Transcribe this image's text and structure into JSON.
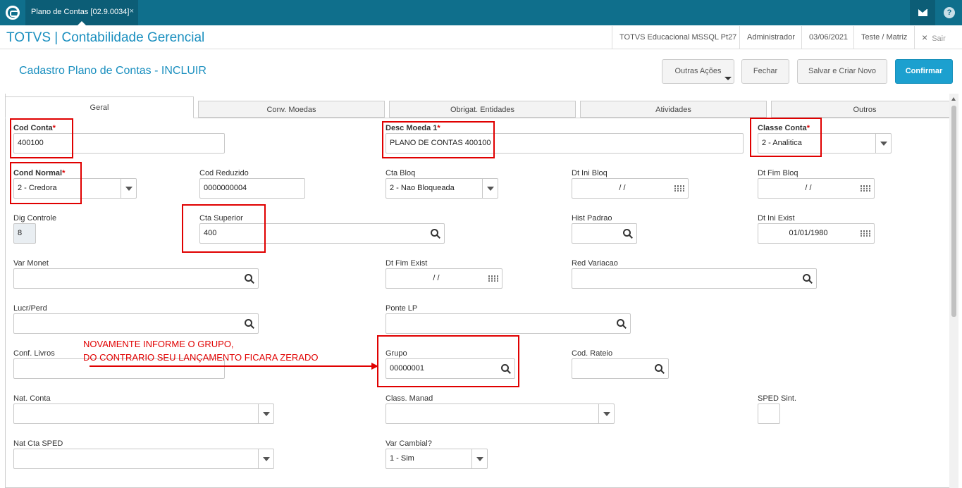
{
  "window": {
    "tab_title": "Plano de Contas [02.9.0034]",
    "tab_close": "×",
    "help": "?"
  },
  "header": {
    "app_title": "TOTVS | Contabilidade Gerencial",
    "environment": "TOTVS Educacional MSSQL Pt27",
    "user": "Administrador",
    "date": "03/06/2021",
    "company": "Teste / Matriz",
    "exit_label": "Sair",
    "exit_icon": "×"
  },
  "page": {
    "title": "Cadastro Plano de Contas - INCLUIR",
    "buttons": {
      "more_actions": "Outras Ações",
      "close": "Fechar",
      "save_new": "Salvar e Criar Novo",
      "confirm": "Confirmar"
    }
  },
  "tabs": [
    "Geral",
    "Conv. Moedas",
    "Obrigat. Entidades",
    "Atividades",
    "Outros"
  ],
  "fields": {
    "cod_conta": {
      "label": "Cod Conta",
      "value": "400100",
      "required": "*"
    },
    "desc_moeda": {
      "label": "Desc Moeda 1",
      "value": "PLANO DE CONTAS 400100",
      "required": "*"
    },
    "classe_conta": {
      "label": "Classe Conta",
      "value": "2 - Analitica",
      "required": "*"
    },
    "cond_normal": {
      "label": "Cond Normal",
      "value": "2 - Credora",
      "required": "*"
    },
    "cod_reduzido": {
      "label": "Cod Reduzido",
      "value": "0000000004"
    },
    "cta_bloq": {
      "label": "Cta Bloq",
      "value": "2 - Nao Bloqueada"
    },
    "dt_ini_bloq": {
      "label": "Dt Ini Bloq",
      "value": "/ /"
    },
    "dt_fim_bloq": {
      "label": "Dt Fim Bloq",
      "value": "/ /"
    },
    "dig_controle": {
      "label": "Dig Controle",
      "value": "8"
    },
    "cta_superior": {
      "label": "Cta Superior",
      "value": "400"
    },
    "hist_padrao": {
      "label": "Hist Padrao",
      "value": ""
    },
    "dt_ini_exist": {
      "label": "Dt Ini Exist",
      "value": "01/01/1980"
    },
    "var_monet": {
      "label": "Var Monet",
      "value": ""
    },
    "dt_fim_exist": {
      "label": "Dt Fim Exist",
      "value": "/ /"
    },
    "red_variacao": {
      "label": "Red Variacao",
      "value": ""
    },
    "lucr_perd": {
      "label": "Lucr/Perd",
      "value": ""
    },
    "ponte_lp": {
      "label": "Ponte LP",
      "value": ""
    },
    "conf_livros": {
      "label": "Conf. Livros",
      "value": ""
    },
    "grupo": {
      "label": "Grupo",
      "value": "00000001"
    },
    "cod_rateio": {
      "label": "Cod. Rateio",
      "value": ""
    },
    "nat_conta": {
      "label": "Nat. Conta",
      "value": ""
    },
    "class_manad": {
      "label": "Class. Manad",
      "value": ""
    },
    "sped_sint": {
      "label": "SPED Sint.",
      "value": ""
    },
    "nat_cta_sped": {
      "label": "Nat Cta SPED",
      "value": ""
    },
    "var_cambial": {
      "label": "Var Cambial?",
      "value": "1 - Sim"
    }
  },
  "annotation": {
    "line1": "NOVAMENTE INFORME O GRUPO,",
    "line2": "DO CONTRARIO SEU LANÇAMENTO FICARA ZERADO",
    "color": "#e00000"
  },
  "colors": {
    "topbar": "#0f6f8c",
    "accent": "#1a8fbf",
    "primary_button": "#1ca0cf"
  }
}
